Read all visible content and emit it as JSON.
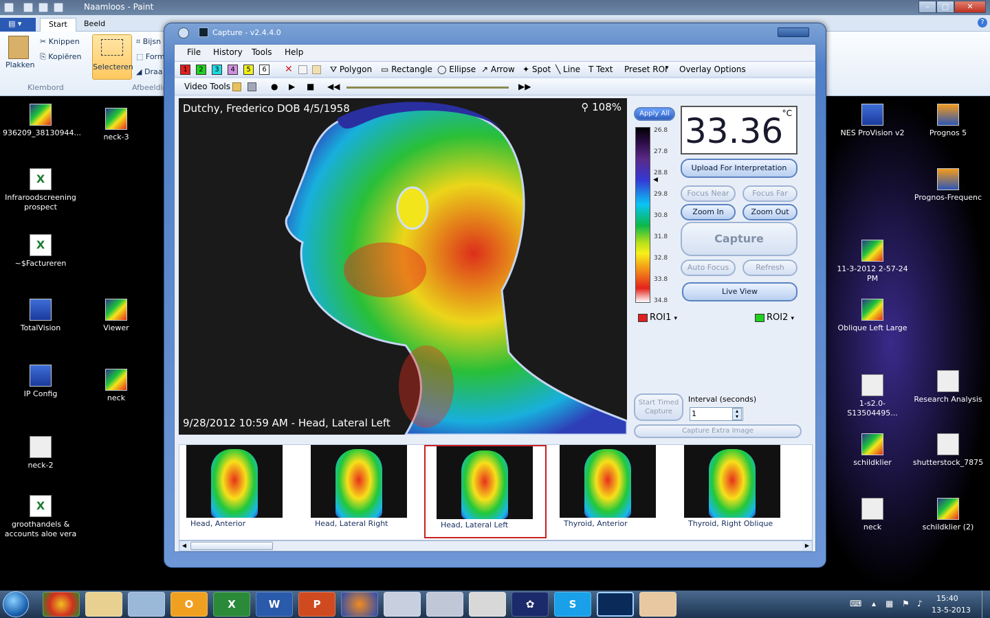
{
  "paint": {
    "title": "Naamloos - Paint",
    "tabs": [
      "Start",
      "Beeld"
    ],
    "ribbon": {
      "paste": "Plakken",
      "cut": "Knippen",
      "copy": "Kopiëren",
      "select": "Selecteren",
      "crop": "Bijsn",
      "resize": "Form",
      "rotate": "Draa",
      "group_clipboard": "Klembord",
      "group_image": "Afbeeldin"
    }
  },
  "desktop_left": [
    {
      "label": "936209_38130944...",
      "kind": "thermal"
    },
    {
      "label": "neck-3",
      "kind": "thermal"
    },
    {
      "label": "Infraroodscreening prospect",
      "kind": "xl"
    },
    {
      "label": "~$Factureren",
      "kind": "xl"
    },
    {
      "label": "TotalVision",
      "kind": "blue"
    },
    {
      "label": "Viewer",
      "kind": "thermal"
    },
    {
      "label": "IP Config",
      "kind": "blue"
    },
    {
      "label": "neck",
      "kind": "thermal"
    },
    {
      "label": "neck-2",
      "kind": "img"
    },
    {
      "label": "groothandels & accounts aloe vera",
      "kind": "xl"
    }
  ],
  "desktop_right": [
    {
      "label": "NES ProVision v2",
      "kind": "blue"
    },
    {
      "label": "Prognos 5",
      "kind": "orange"
    },
    {
      "label": "Prognos-Frequenc",
      "kind": "orange"
    },
    {
      "label": "11-3-2012 2-57-24 PM",
      "kind": "thermal"
    },
    {
      "label": "Oblique Left Large",
      "kind": "thermal"
    },
    {
      "label": "1-s2.0-S13504495...",
      "kind": "img"
    },
    {
      "label": "Research Analysis",
      "kind": "img"
    },
    {
      "label": "schildklier",
      "kind": "thermal"
    },
    {
      "label": "shutterstock_7875",
      "kind": "img"
    },
    {
      "label": "neck",
      "kind": "img"
    },
    {
      "label": "schildklier (2)",
      "kind": "thermal"
    }
  ],
  "capture": {
    "title": "Capture - v2.4.4.0",
    "menu": [
      "File",
      "History",
      "Tools",
      "Help"
    ],
    "swatches": [
      "1",
      "2",
      "3",
      "4",
      "5",
      "6"
    ],
    "swatch_colors": [
      "#e02020",
      "#22d022",
      "#22d8e0",
      "#d090e0",
      "#f0f020",
      "#ffffff"
    ],
    "tools": [
      "Polygon",
      "Rectangle",
      "Ellipse",
      "Arrow",
      "Spot",
      "Line",
      "Text",
      "Preset ROI",
      "Overlay Options"
    ],
    "video_tools": "Video Tools",
    "patient": "Dutchy, Frederico DOB 4/5/1958",
    "zoom": "108%",
    "image_footer": "9/28/2012 10:59  AM - Head, Lateral Left",
    "apply_all": "Apply All",
    "temperature": "33.36",
    "unit": "°C",
    "scale_ticks": [
      "26.8",
      "27.8",
      "28.8",
      "29.8",
      "30.8",
      "31.8",
      "32.8",
      "33.8",
      "34.8"
    ],
    "buttons": {
      "upload": "Upload For Interpretation",
      "focus_near": "Focus Near",
      "focus_far": "Focus Far",
      "zoom_in": "Zoom In",
      "zoom_out": "Zoom Out",
      "capture": "Capture",
      "auto_focus": "Auto Focus",
      "refresh": "Refresh",
      "live_view": "Live View",
      "start_timed": "Start Timed Capture",
      "capture_extra": "Capture Extra Image"
    },
    "roi1": "ROI1",
    "roi2": "ROI2",
    "interval_label": "Interval (seconds)",
    "interval_value": "1",
    "thumbnails": [
      "Head, Anterior",
      "Head, Lateral Right",
      "Head, Lateral Left",
      "Thyroid, Anterior",
      "Thyroid, Right Oblique"
    ]
  },
  "taskbar": {
    "time": "15:40",
    "date": "13-5-2013"
  }
}
